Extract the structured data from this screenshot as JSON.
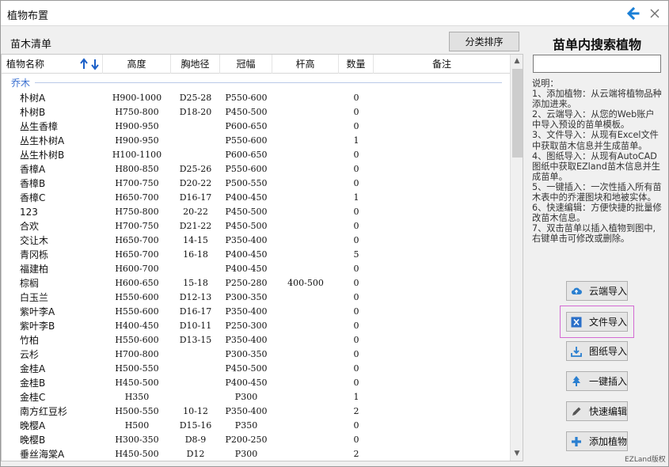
{
  "window": {
    "title": "植物布置"
  },
  "list": {
    "label": "苗木清单",
    "sort_button": "分类排序"
  },
  "table": {
    "headers": [
      "植物名称",
      "高度",
      "胸地径",
      "冠幅",
      "杆高",
      "数量",
      "备注"
    ],
    "group": "乔木",
    "rows": [
      {
        "name": "朴树A",
        "height": "H900-1000",
        "dbh": "D25-28",
        "crown": "P550-600",
        "stem": "",
        "qty": "0"
      },
      {
        "name": "朴树B",
        "height": "H750-800",
        "dbh": "D18-20",
        "crown": "P450-500",
        "stem": "",
        "qty": "0"
      },
      {
        "name": "丛生香樟",
        "height": "H900-950",
        "dbh": "",
        "crown": "P600-650",
        "stem": "",
        "qty": "0"
      },
      {
        "name": "丛生朴树A",
        "height": "H900-950",
        "dbh": "",
        "crown": "P550-600",
        "stem": "",
        "qty": "1"
      },
      {
        "name": "丛生朴树B",
        "height": "H100-1100",
        "dbh": "",
        "crown": "P600-650",
        "stem": "",
        "qty": "0"
      },
      {
        "name": "香樟A",
        "height": "H800-850",
        "dbh": "D25-26",
        "crown": "P550-600",
        "stem": "",
        "qty": "0"
      },
      {
        "name": "香樟B",
        "height": "H700-750",
        "dbh": "D20-22",
        "crown": "P500-550",
        "stem": "",
        "qty": "0"
      },
      {
        "name": "香樟C",
        "height": "H650-700",
        "dbh": "D16-17",
        "crown": "P400-450",
        "stem": "",
        "qty": "1"
      },
      {
        "name": "123",
        "height": "H750-800",
        "dbh": "20-22",
        "crown": "P450-500",
        "stem": "",
        "qty": "0"
      },
      {
        "name": "合欢",
        "height": "H700-750",
        "dbh": "D21-22",
        "crown": "P450-500",
        "stem": "",
        "qty": "0"
      },
      {
        "name": "交让木",
        "height": "H650-700",
        "dbh": "14-15",
        "crown": "P350-400",
        "stem": "",
        "qty": "0"
      },
      {
        "name": "青冈栎",
        "height": "H650-700",
        "dbh": "16-18",
        "crown": "P400-450",
        "stem": "",
        "qty": "5"
      },
      {
        "name": "福建柏",
        "height": "H600-700",
        "dbh": "",
        "crown": "P400-450",
        "stem": "",
        "qty": "0"
      },
      {
        "name": "棕榈",
        "height": "H600-650",
        "dbh": "15-18",
        "crown": "P250-280",
        "stem": "400-500",
        "qty": "0"
      },
      {
        "name": "白玉兰",
        "height": "H550-600",
        "dbh": "D12-13",
        "crown": "P300-350",
        "stem": "",
        "qty": "0"
      },
      {
        "name": "紫叶李A",
        "height": "H550-600",
        "dbh": "D16-17",
        "crown": "P350-400",
        "stem": "",
        "qty": "0"
      },
      {
        "name": "紫叶李B",
        "height": "H400-450",
        "dbh": "D10-11",
        "crown": "P250-300",
        "stem": "",
        "qty": "0"
      },
      {
        "name": "竹柏",
        "height": "H550-600",
        "dbh": "D13-15",
        "crown": "P350-400",
        "stem": "",
        "qty": "0"
      },
      {
        "name": "云杉",
        "height": "H700-800",
        "dbh": "",
        "crown": "P300-350",
        "stem": "",
        "qty": "0"
      },
      {
        "name": "金桂A",
        "height": "H500-550",
        "dbh": "",
        "crown": "P450-500",
        "stem": "",
        "qty": "0"
      },
      {
        "name": "金桂B",
        "height": "H450-500",
        "dbh": "",
        "crown": "P400-450",
        "stem": "",
        "qty": "0"
      },
      {
        "name": "金桂C",
        "height": "H350",
        "dbh": "",
        "crown": "P300",
        "stem": "",
        "qty": "1"
      },
      {
        "name": "南方红豆杉",
        "height": "H500-550",
        "dbh": "10-12",
        "crown": "P350-400",
        "stem": "",
        "qty": "2"
      },
      {
        "name": "晚樱A",
        "height": "H500",
        "dbh": "D15-16",
        "crown": "P350",
        "stem": "",
        "qty": "0"
      },
      {
        "name": "晚樱B",
        "height": "H300-350",
        "dbh": "D8-9",
        "crown": "P200-250",
        "stem": "",
        "qty": "0"
      },
      {
        "name": "垂丝海棠A",
        "height": "H450-500",
        "dbh": "D12",
        "crown": "P300",
        "stem": "",
        "qty": "2"
      }
    ]
  },
  "search": {
    "title": "苗单内搜索植物",
    "value": ""
  },
  "help": {
    "lines": [
      "说明：",
      "1、添加植物：从云端将植物品种添加进来。",
      "2、云端导入：从您的Web账户中导入预设的苗单模板。",
      "3、文件导入：从现有Excel文件中获取苗木信息并生成苗单。",
      "4、图纸导入：从现有AutoCAD图纸中获取EZland苗木信息并生成苗单。",
      "5、一键插入：一次性插入所有苗木表中的乔灌图块和地被实体。",
      "6、快速编辑：方便快捷的批量修改苗木信息。",
      "7、双击苗单以插入植物到图中,右键单击可修改或删除。"
    ]
  },
  "buttons": {
    "cloud_import": "云端导入",
    "file_import": "文件导入",
    "drawing_import": "图纸导入",
    "one_click_insert": "一键插入",
    "quick_edit": "快速编辑",
    "add_plant": "添加植物"
  },
  "footer": "EZLand版权",
  "colors": {
    "accent": "#1a7fd6",
    "group": "#3a6fd0",
    "highlight": "#d36ad3"
  }
}
